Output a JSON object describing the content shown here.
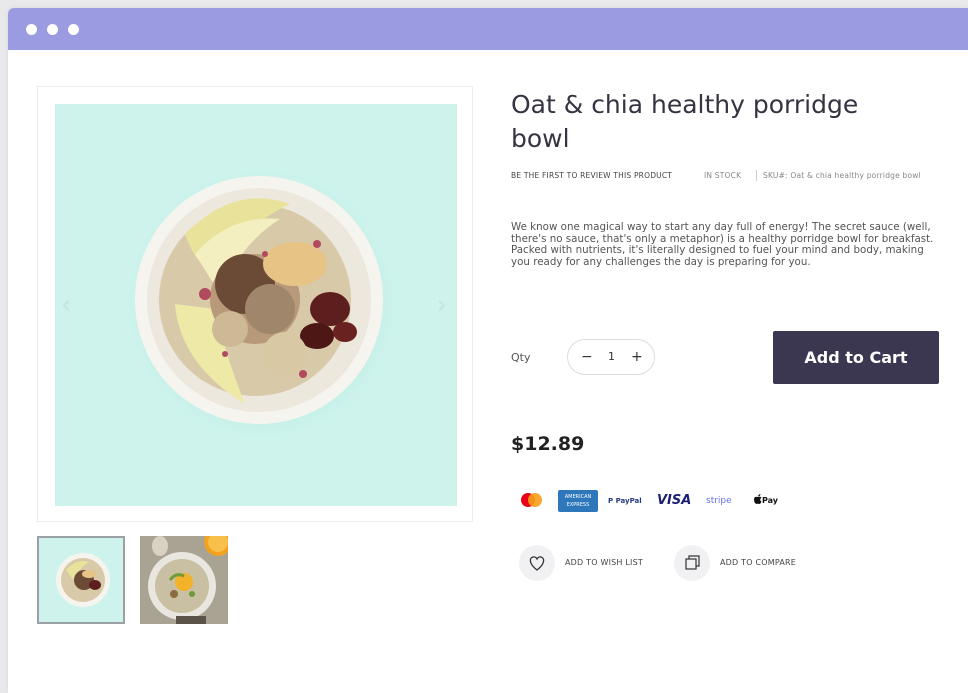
{
  "window": {
    "titlebar_color": "#9b9be2"
  },
  "gallery": {
    "main_image_alt": "Oat & chia porridge bowl with pear slices",
    "prev_arrow": "‹",
    "next_arrow": "›",
    "thumbnails": [
      {
        "name": "porridge-bowl-thumbnail"
      },
      {
        "name": "porridge-orange-thumbnail"
      }
    ]
  },
  "product": {
    "title": "Oat & chia healthy porridge bowl",
    "review_link": "BE THE FIRST TO REVIEW THIS PRODUCT",
    "stock": "IN STOCK",
    "sku": "SKU#: Oat & chia healthy porridge bowl",
    "description": "We know one magical way to start any day full of energy! The secret sauce (well, there's no sauce, that's only a metaphor) is a healthy porridge bowl for breakfast. Packed with nutrients, it's literally designed to fuel your mind and body, making you ready for any challenges the day is preparing for you.",
    "qty_label": "Qty",
    "qty_minus": "−",
    "qty_value": "1",
    "qty_plus": "+",
    "add_to_cart": "Add to Cart",
    "price": "$12.89",
    "accent_color": "#3c3751"
  },
  "payments": {
    "amex": "AMERICAN EXPRESS",
    "paypal": "P PayPal",
    "visa": "VISA",
    "stripe": "stripe",
    "apple_pay": "Pay"
  },
  "actions": {
    "wish_list": "ADD TO WISH LIST",
    "compare": "ADD TO COMPARE"
  }
}
